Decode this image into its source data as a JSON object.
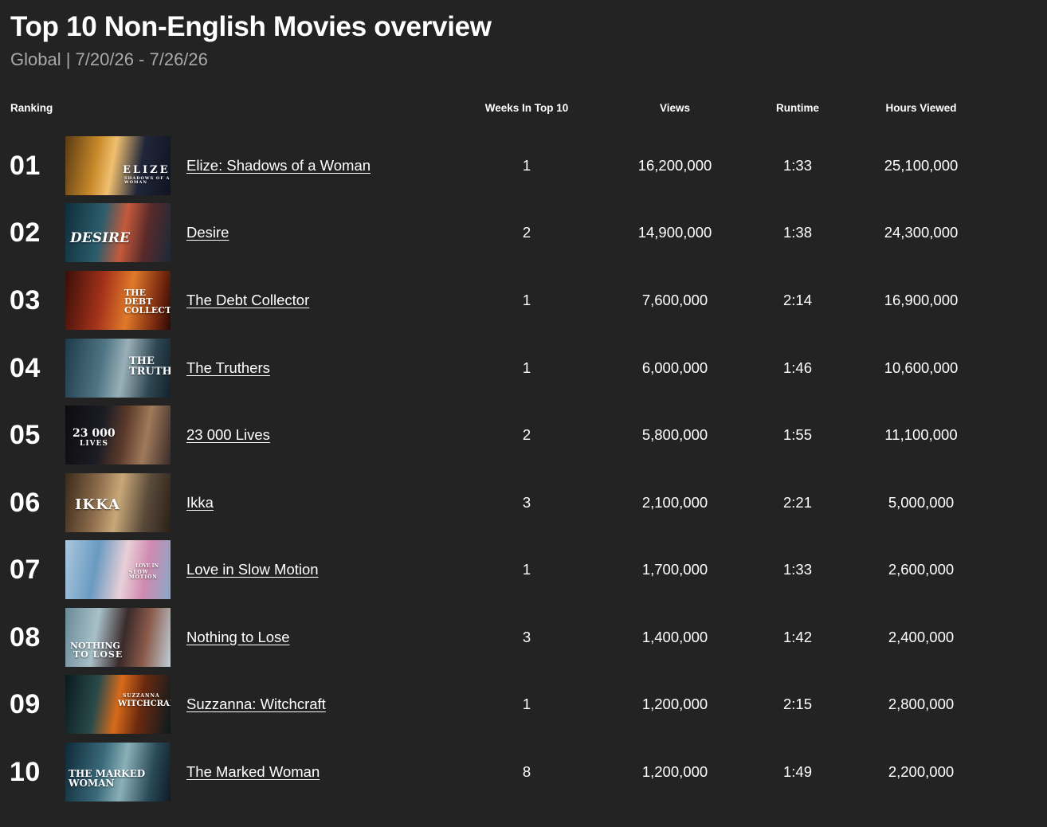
{
  "header": {
    "title": "Top 10 Non-English Movies overview",
    "subtitle": "Global | 7/20/26 - 7/26/26"
  },
  "columns": {
    "ranking": "Ranking",
    "weeks": "Weeks In Top 10",
    "views": "Views",
    "runtime": "Runtime",
    "hours": "Hours Viewed"
  },
  "rows": [
    {
      "rank": "01",
      "title": "Elize: Shadows of a Woman",
      "weeks": "1",
      "views": "16,200,000",
      "runtime": "1:33",
      "hours": "25,100,000",
      "poster_text": "ELIZE",
      "poster_sub": "SHADOWS OF A WOMAN"
    },
    {
      "rank": "02",
      "title": "Desire",
      "weeks": "2",
      "views": "14,900,000",
      "runtime": "1:38",
      "hours": "24,300,000",
      "poster_text": "DESIRE",
      "poster_sub": ""
    },
    {
      "rank": "03",
      "title": "The Debt Collector",
      "weeks": "1",
      "views": "7,600,000",
      "runtime": "2:14",
      "hours": "16,900,000",
      "poster_text": "THE DEBT COLLECTOR",
      "poster_sub": ""
    },
    {
      "rank": "04",
      "title": "The Truthers",
      "weeks": "1",
      "views": "6,000,000",
      "runtime": "1:46",
      "hours": "10,600,000",
      "poster_text": "THE TRUTHERS",
      "poster_sub": ""
    },
    {
      "rank": "05",
      "title": "23 000 Lives",
      "weeks": "2",
      "views": "5,800,000",
      "runtime": "1:55",
      "hours": "11,100,000",
      "poster_text": "23 000",
      "poster_sub": "LIVES"
    },
    {
      "rank": "06",
      "title": "Ikka",
      "weeks": "3",
      "views": "2,100,000",
      "runtime": "2:21",
      "hours": "5,000,000",
      "poster_text": "IKKA",
      "poster_sub": ""
    },
    {
      "rank": "07",
      "title": "Love in Slow Motion",
      "weeks": "1",
      "views": "1,700,000",
      "runtime": "1:33",
      "hours": "2,600,000",
      "poster_text": "LOVE IN",
      "poster_sub": "SLOW MOTION"
    },
    {
      "rank": "08",
      "title": "Nothing to Lose",
      "weeks": "3",
      "views": "1,400,000",
      "runtime": "1:42",
      "hours": "2,400,000",
      "poster_text": "NOTHING",
      "poster_sub": "TO LOSE"
    },
    {
      "rank": "09",
      "title": "Suzzanna: Witchcraft",
      "weeks": "1",
      "views": "1,200,000",
      "runtime": "2:15",
      "hours": "2,800,000",
      "poster_text": "WITCHCRAFT",
      "poster_sub": "SUZZANNA"
    },
    {
      "rank": "10",
      "title": "The Marked Woman",
      "weeks": "8",
      "views": "1,200,000",
      "runtime": "1:49",
      "hours": "2,200,000",
      "poster_text": "THE MARKED WOMAN",
      "poster_sub": ""
    }
  ]
}
